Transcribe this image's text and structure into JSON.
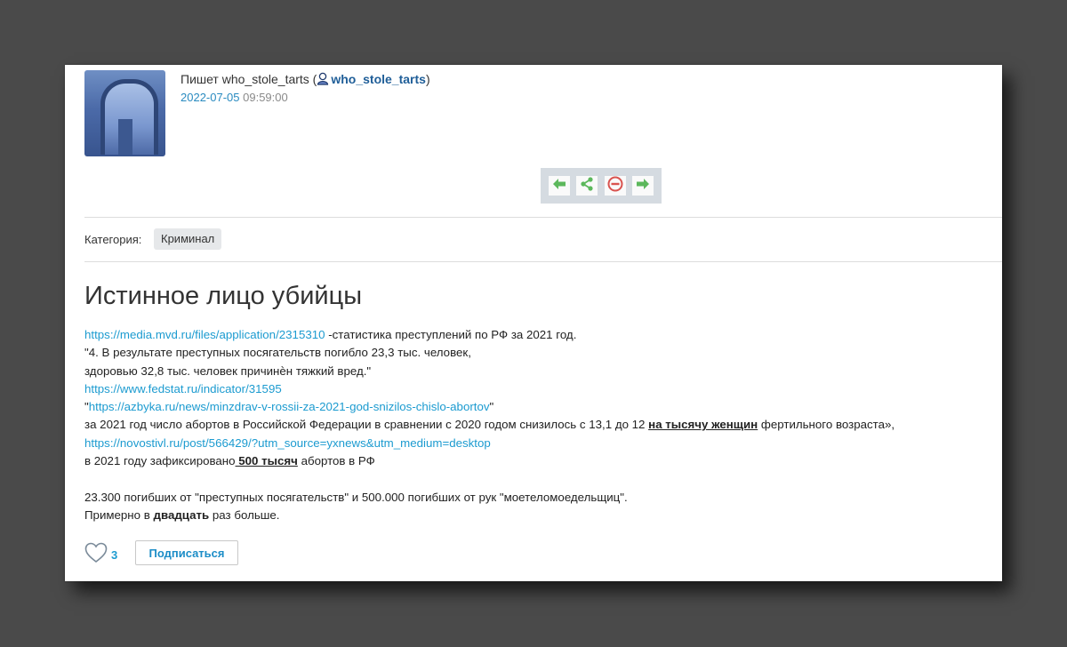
{
  "author": {
    "prefix": "Пишет who_stole_tarts (",
    "username": "who_stole_tarts",
    "suffix": ")",
    "date": "2022-07-05",
    "time": "09:59:00"
  },
  "nav": {
    "icons": [
      "arrow-left-icon",
      "share-icon",
      "block-icon",
      "arrow-right-icon"
    ],
    "colors": {
      "arrow": "#5cb85c",
      "block": "#d9534f"
    }
  },
  "category": {
    "label": "Категория:",
    "value": "Криминал"
  },
  "post": {
    "title": "Истинное лицо убийцы",
    "link1": "https://media.mvd.ru/files/application/2315310",
    "link1_desc": " -статистика преступлений по РФ за 2021 год.",
    "quote1": "\"4. В результате преступных посягательств погибло 23,3 тыс. человек,",
    "quote2": "здоровью 32,8 тыс. человек причинѐн тяжкий вред.\"",
    "link2": "https://www.fedstat.ru/indicator/31595",
    "link3_open": "\"",
    "link3": "https://azbyka.ru/news/minzdrav-v-rossii-za-2021-god-snizilos-chislo-abortov",
    "link3_close": "\"",
    "abort_text1": "за 2021 год число абортов в Российской Федерации в сравнении с 2020 годом снизилось с 13,1 до 12 ",
    "abort_emph": "на тысячу женщин",
    "abort_text2": " фертильного возраста»,",
    "link4": "https://novostivl.ru/post/566429/?utm_source=yxnews&utm_medium=desktop",
    "fixed_text1": "в 2021 году зафиксировано",
    "fixed_emph": " 500 тысяч",
    "fixed_text2": " абортов в РФ",
    "summary": "23.300 погибших от \"преступных посягательств\" и 500.000 погибших от рук \"моетеломоедельщиц\".",
    "approx_text1": "Примерно в ",
    "approx_emph": "двадцать",
    "approx_text2": " раз больше."
  },
  "footer": {
    "like_count": "3",
    "subscribe_label": "Подписаться"
  },
  "colors": {
    "link": "#1c9bd0",
    "background": "#4a4a4a",
    "card": "#ffffff"
  }
}
